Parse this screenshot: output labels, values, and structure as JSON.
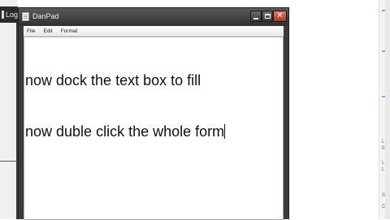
{
  "background": {
    "left_window_title": "Log",
    "right_window_marks": [
      "L",
      "E",
      "L",
      "L",
      "S",
      "C"
    ]
  },
  "window": {
    "title": "DanPad",
    "icon": "notepad-icon",
    "controls": {
      "minimize": "minimize-icon",
      "maximize": "maximize-icon",
      "close_symbol": "✕"
    }
  },
  "menu": {
    "items": [
      "File",
      "Edit",
      "Format"
    ]
  },
  "editor": {
    "lines": [
      "now dock the text box to fill",
      "now duble click the whole form"
    ]
  },
  "colors": {
    "titlebar": "#3b3b3b",
    "close_button": "#c4412c",
    "editor_background": "#ffffff",
    "text": "#111111"
  }
}
